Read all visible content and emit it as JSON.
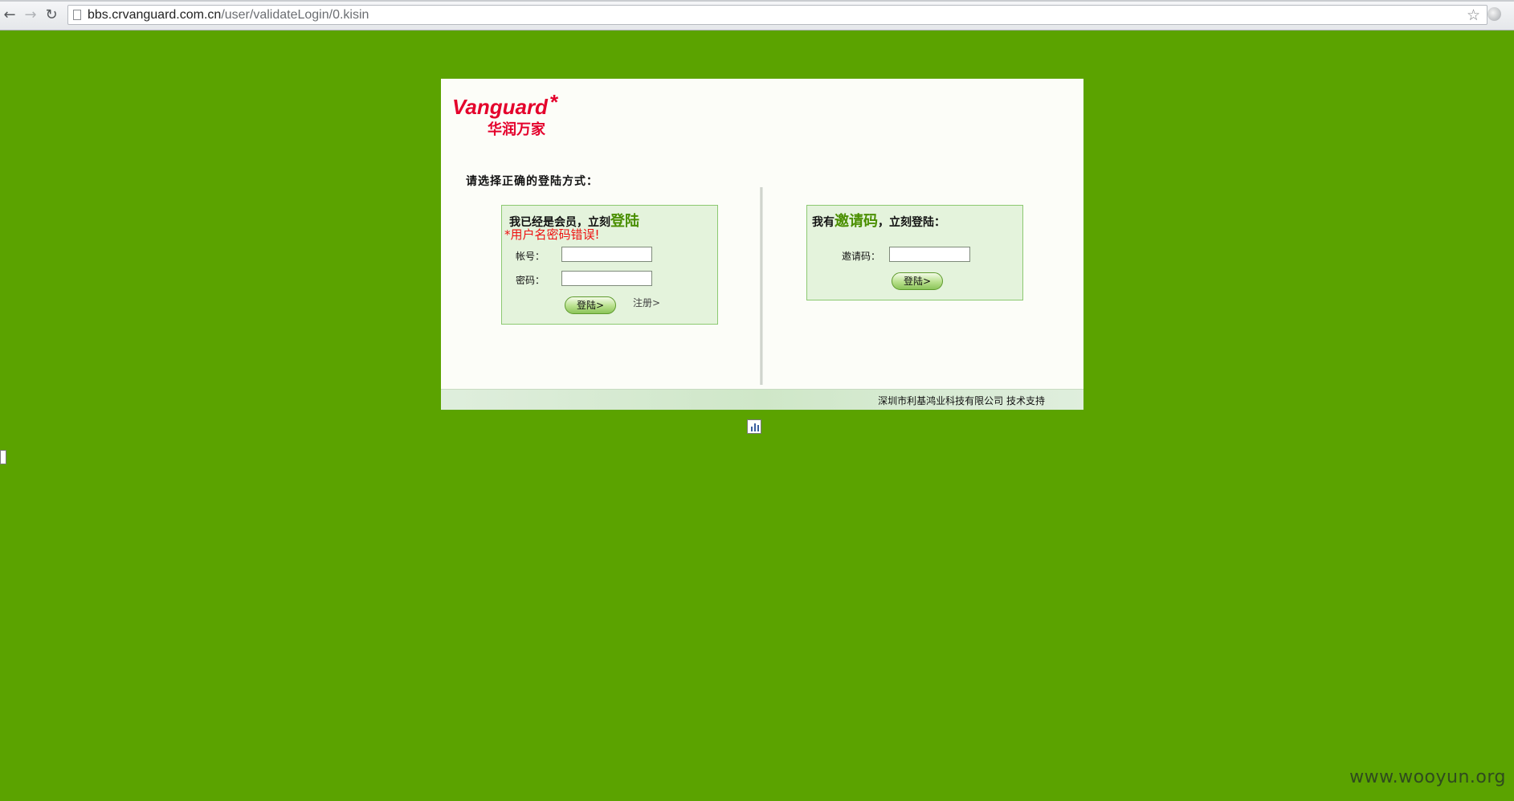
{
  "browser": {
    "url_host": "bbs.crvanguard.com.cn",
    "url_path": "/user/validateLogin/0.kisin",
    "back_icon": "back-arrow-icon",
    "forward_icon": "forward-arrow-icon",
    "reload_icon": "reload-icon"
  },
  "logo": {
    "brand_en": "Vanguard",
    "brand_cn": "华润万家",
    "brand_color": "#e4002b"
  },
  "page": {
    "prompt": "请选择正确的登陆方式："
  },
  "member_login": {
    "title_prefix": "我已经是会员，立刻",
    "title_highlight": "登陆",
    "error": "*用户名密码错误!",
    "account_label": "帐号：",
    "account_value": "",
    "password_label": "密码：",
    "password_value": "",
    "login_button": "登陆>",
    "register_link": "注册>"
  },
  "invite_login": {
    "title_prefix": "我有",
    "title_highlight": "邀请码",
    "title_suffix": "，立刻登陆：",
    "code_label": "邀请码：",
    "code_value": "",
    "login_button": "登陆>"
  },
  "footer": {
    "text": "深圳市利基鸿业科技有限公司  技术支持"
  },
  "watermark": "www.wooyun.org",
  "colors": {
    "page_background": "#5ba300",
    "highlight_green": "#4a8f00",
    "error_red": "#ee1111"
  }
}
